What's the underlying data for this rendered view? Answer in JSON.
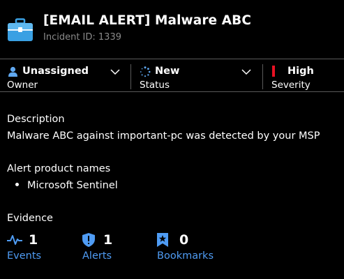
{
  "header": {
    "title": "[EMAIL ALERT] Malware ABC",
    "incident_id": "Incident ID: 1339",
    "icon": "briefcase-icon"
  },
  "fields": {
    "owner": {
      "value": "Unassigned",
      "label": "Owner",
      "icon": "person-icon"
    },
    "status": {
      "value": "New",
      "label": "Status",
      "icon": "spinner-icon"
    },
    "severity": {
      "value": "High",
      "label": "Severity",
      "icon": "severity-bar-icon",
      "color": "#e81123"
    }
  },
  "description": {
    "label": "Description",
    "text": "Malware ABC against important-pc was detected by your MSP"
  },
  "alert_products": {
    "label": "Alert product names",
    "items": [
      "Microsoft Sentinel"
    ]
  },
  "evidence": {
    "label": "Evidence",
    "items": [
      {
        "count": "1",
        "name": "Events",
        "icon": "activity-pulse-icon"
      },
      {
        "count": "1",
        "name": "Alerts",
        "icon": "shield-alert-icon"
      },
      {
        "count": "0",
        "name": "Bookmarks",
        "icon": "bookmark-star-icon"
      }
    ]
  },
  "colors": {
    "background": "#000000",
    "link": "#4f9cf4",
    "divider": "#5a5a5a",
    "subtle_text": "#8a8a8a"
  }
}
